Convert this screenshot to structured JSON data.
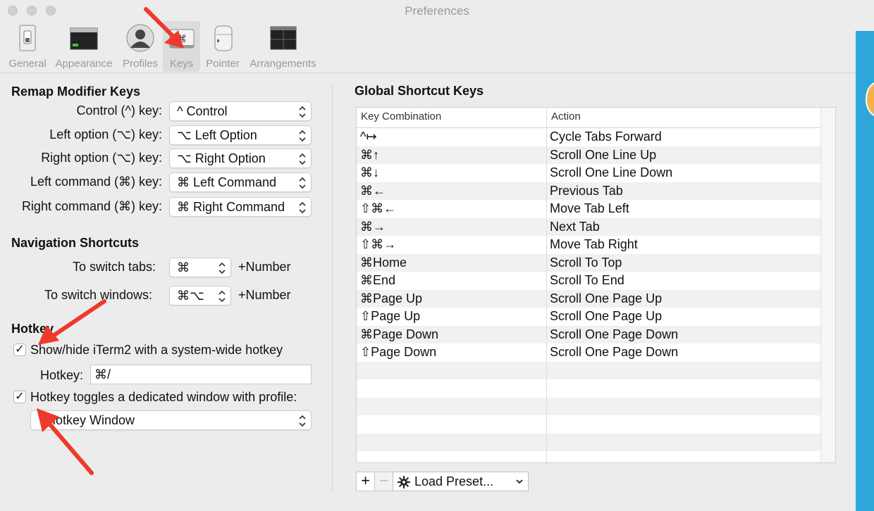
{
  "window": {
    "title": "Preferences"
  },
  "toolbar": {
    "items": [
      {
        "label": "General",
        "icon": "general-switch-icon"
      },
      {
        "label": "Appearance",
        "icon": "appearance-window-icon"
      },
      {
        "label": "Profiles",
        "icon": "profiles-person-icon"
      },
      {
        "label": "Keys",
        "icon": "keys-command-icon",
        "selected": true
      },
      {
        "label": "Pointer",
        "icon": "pointer-mouse-icon"
      },
      {
        "label": "Arrangements",
        "icon": "arrangements-windows-icon"
      }
    ]
  },
  "remap": {
    "heading": "Remap Modifier Keys",
    "rows": [
      {
        "label": "Control (^) key:",
        "value": "^ Control"
      },
      {
        "label": "Left option (⌥) key:",
        "value": "⌥ Left Option"
      },
      {
        "label": "Right option (⌥) key:",
        "value": "⌥ Right Option"
      },
      {
        "label": "Left command (⌘) key:",
        "value": "⌘ Left Command"
      },
      {
        "label": "Right command (⌘) key:",
        "value": "⌘ Right Command"
      }
    ]
  },
  "navigation": {
    "heading": "Navigation Shortcuts",
    "tabs_label": "To switch tabs:",
    "tabs_value": "⌘",
    "tabs_suffix": "+Number",
    "windows_label": "To switch windows:",
    "windows_value": "⌘⌥",
    "windows_suffix": "+Number"
  },
  "hotkey": {
    "heading": "Hotkey",
    "showhide_label": "Show/hide iTerm2 with a system-wide hotkey",
    "showhide_checked": true,
    "hotkey_label": "Hotkey:",
    "hotkey_value": "⌘/",
    "dedicated_label": "Hotkey toggles a dedicated window with profile:",
    "dedicated_checked": true,
    "profile_value": "Hotkey Window"
  },
  "global": {
    "heading": "Global Shortcut Keys",
    "col_key": "Key Combination",
    "col_action": "Action",
    "rows": [
      {
        "key": "^↦",
        "action": "Cycle Tabs Forward"
      },
      {
        "key": "⌘↑",
        "action": "Scroll One Line Up"
      },
      {
        "key": "⌘↓",
        "action": "Scroll One Line Down"
      },
      {
        "key": "⌘←",
        "action": "Previous Tab"
      },
      {
        "key": "⇧⌘←",
        "action": "Move Tab Left"
      },
      {
        "key": "⌘→",
        "action": "Next Tab"
      },
      {
        "key": "⇧⌘→",
        "action": "Move Tab Right"
      },
      {
        "key": "⌘Home",
        "action": "Scroll To Top"
      },
      {
        "key": "⌘End",
        "action": "Scroll To End"
      },
      {
        "key": "⌘Page Up",
        "action": "Scroll One Page Up"
      },
      {
        "key": "⇧Page Up",
        "action": "Scroll One Page Up"
      },
      {
        "key": "⌘Page Down",
        "action": "Scroll One Page Down"
      },
      {
        "key": "⇧Page Down",
        "action": "Scroll One Page Down"
      }
    ],
    "add_label": "+",
    "remove_label": "−",
    "preset_label": "Load Preset..."
  },
  "colors": {
    "annotation_arrow": "#ee3a2c",
    "side_window": "#2fa6da",
    "window_bg": "#ececec"
  }
}
